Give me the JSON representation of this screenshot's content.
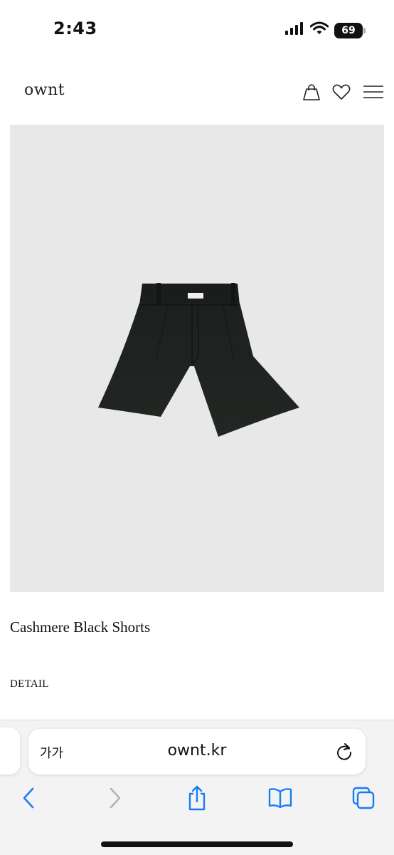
{
  "status_bar": {
    "time": "2:43",
    "battery": "69"
  },
  "header": {
    "logo": "ownt",
    "icons": [
      "shopping-bag-icon",
      "heart-icon",
      "menu-icon"
    ]
  },
  "product": {
    "image_alt": "black shorts product photo",
    "title": "Cashmere Black Shorts",
    "detail_label": "DETAIL"
  },
  "browser": {
    "text_size_label": "가가",
    "url": "ownt.kr",
    "toolbar_icons": [
      "back-icon",
      "forward-icon",
      "share-icon",
      "bookmarks-icon",
      "tabs-icon"
    ]
  },
  "colors": {
    "image_background": "#e8e8e9",
    "accent": "#1a7cf5",
    "chrome_background": "#f3f3f4"
  }
}
